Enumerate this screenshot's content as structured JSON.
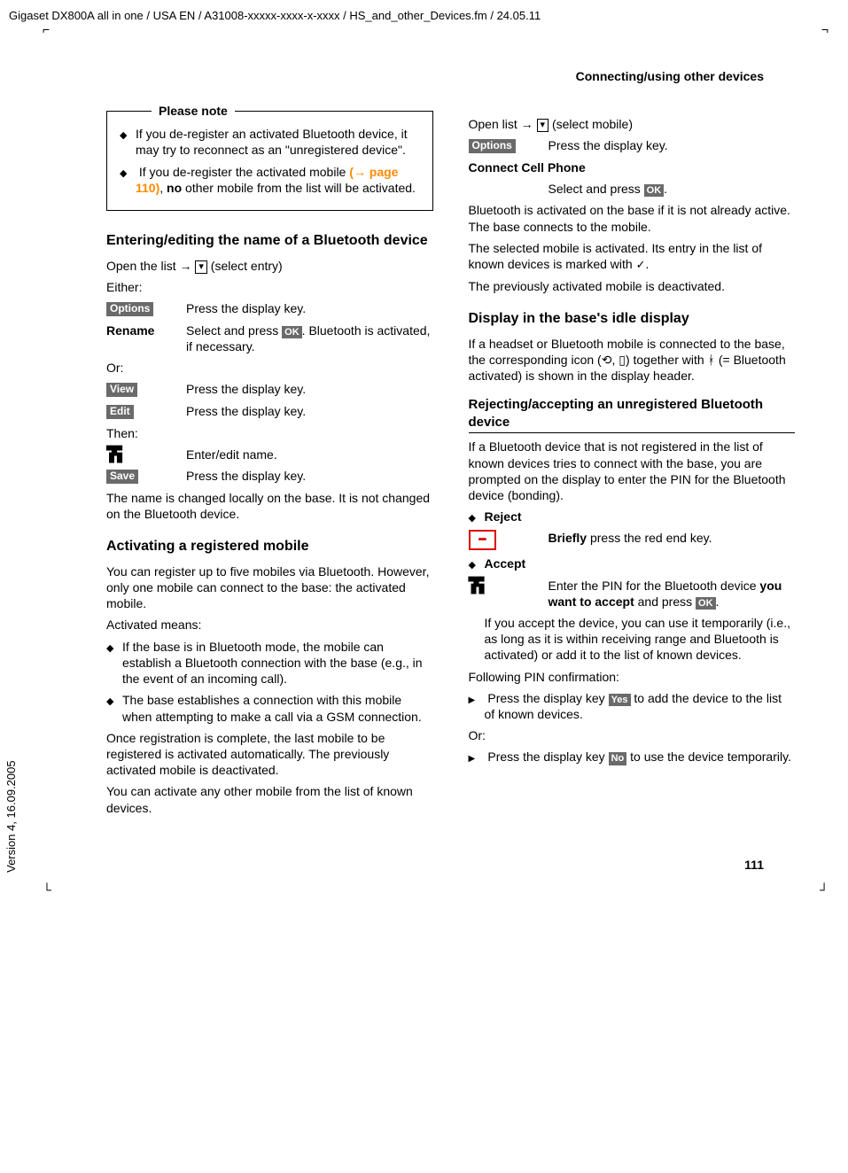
{
  "top_header": "Gigaset DX800A all in one / USA EN / A31008-xxxxx-xxxx-x-xxxx / HS_and_other_Devices.fm / 24.05.11",
  "section_header": "Connecting/using other devices",
  "side_text": "Version 4, 16.09.2005",
  "page_number": "111",
  "note": {
    "title": "Please note",
    "b1a": "If you de-register an activated Blue­tooth device, it may try to reconnect as an \"unregistered device\".",
    "b2a": "If you de-register the activated mobile ",
    "b2link_open": "(",
    "b2link_page": "page 110)",
    "b2b": ", ",
    "b2b_bold": "no",
    "b2c": " other mobile from the list will be activated."
  },
  "left": {
    "h_entering": "Entering/editing the name of a Bluetooth device",
    "open_list_a": "Open the list ",
    "open_list_b": " (select entry)",
    "either": "Either:",
    "options_desc": "Press the display key.",
    "rename_label": "Rename",
    "rename_desc_a": "Select and press ",
    "rename_desc_b": ". Bluetooth is activated, if necessary.",
    "or": "Or:",
    "view_desc": "Press the display key.",
    "edit_desc": "Press the display key.",
    "then": "Then:",
    "enter_name": "Enter/edit name.",
    "save_desc": "Press the display key.",
    "p_name_changed": "The name is changed locally on the base. It is not changed on the Bluetooth device.",
    "h_activating": "Activating a registered mobile",
    "p_activ1": "You can register up to five mobiles via Blue­tooth. However, only one mobile can con­nect to the base: the activated mobile.",
    "p_activ2": "Activated means:",
    "act_b1": "If the base is in Bluetooth mode, the mobile can establish a Bluetooth connec­tion with the base (e.g., in the event of an incoming call).",
    "act_b2": "The base establishes a connection with this mobile when attempting to make a call via a GSM connection.",
    "p_once": "Once registration is complete, the last mobile to be registered is activated auto­matically. The previously activated mobile is deactivated.",
    "p_anyother": "You can activate any other mobile from the list of known devices."
  },
  "right": {
    "open_list_a": "Open list ",
    "open_list_b": " (select mobile)",
    "options_desc": "Press the display key.",
    "connect_label": "Connect Cell Phone",
    "connect_desc_a": "Select and press ",
    "connect_desc_b": ".",
    "p_bt_activated": "Bluetooth is activated on the base if it is not already active. The base connects to the mobile.",
    "p_selected_a": "The selected mobile is activated. Its entry in the list of known devices is marked with ",
    "p_selected_b": ".",
    "p_prev": "The previously activated mobile is deacti­vated.",
    "h_display": "Display in the base's idle display",
    "p_display_a": "If a headset or Bluetooth mobile is con­nected to the base, the corresponding icon (",
    "p_display_b": ") together with ",
    "p_display_c": " (= Bluetooth acti­vated) is shown in the display header.",
    "h_reject": "Rejecting/accepting an unregistered Bluetooth device",
    "p_reject": "If a Bluetooth device that is not registered in the list of known devices tries to connect with the base, you are prompted on the dis­play to enter the PIN for the Bluetooth device (bonding).",
    "b_reject": "Reject",
    "reject_desc_a": "Briefly",
    "reject_desc_b": " press the red end key.",
    "b_accept": "Accept",
    "accept_desc_a": "Enter the PIN for the Bluetooth device ",
    "accept_desc_bold": "you want to accept",
    "accept_desc_b": " and press ",
    "accept_desc_c": ".",
    "accept_p": "If you accept the device, you can use it temporarily (i.e., as long as it is within receiving range and Bluetooth is acti­vated) or add it to the list of known devices.",
    "p_following": "Following PIN confirmation:",
    "yes_a": "Press the display key ",
    "yes_b": " to add the device to the list of known devices.",
    "or": "Or:",
    "no_a": "Press the display key ",
    "no_b": " to use the device temporarily."
  },
  "keys": {
    "options": "Options",
    "view": "View",
    "edit": "Edit",
    "save": "Save",
    "ok": "OK",
    "yes": "Yes",
    "no": "No"
  }
}
